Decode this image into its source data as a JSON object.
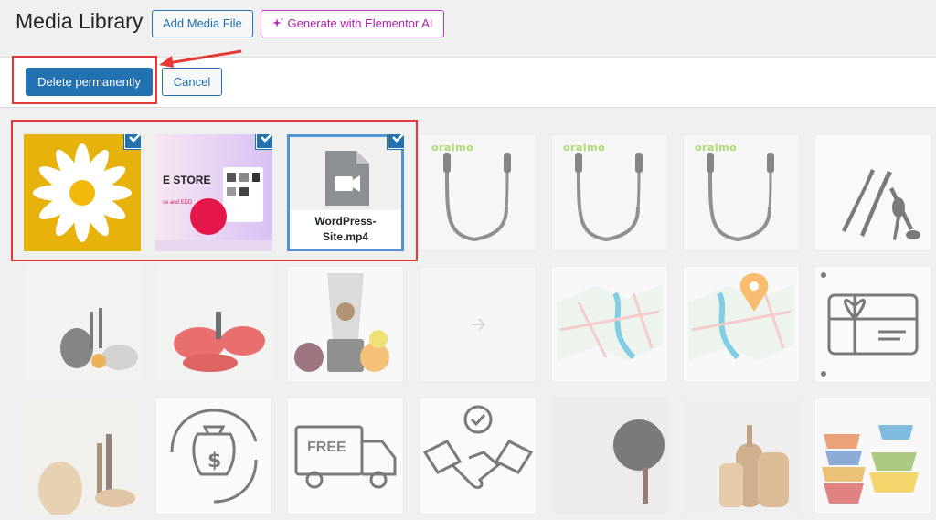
{
  "header": {
    "title": "Media Library",
    "add_media": "Add Media File",
    "generate_ai": "Generate with Elementor AI"
  },
  "toolbar": {
    "delete_permanently": "Delete permanently",
    "cancel": "Cancel"
  },
  "grid": {
    "items": [
      {
        "name": "daisy-flower",
        "selected": true
      },
      {
        "name": "store-theme-screenshot",
        "selected": true,
        "label": "STORE"
      },
      {
        "name": "video-file",
        "selected": true,
        "filename": "WordPress-Site.mp4"
      },
      {
        "name": "neckband-earphones",
        "brand": "oraimo"
      },
      {
        "name": "neckband-earphones",
        "brand": "oraimo"
      },
      {
        "name": "neckband-earphones",
        "brand": "oraimo"
      },
      {
        "name": "cutlery-icon"
      },
      {
        "name": "kitchen-kettle-set"
      },
      {
        "name": "red-cookware-set"
      },
      {
        "name": "blender-with-fruits"
      },
      {
        "name": "blank-placeholder"
      },
      {
        "name": "folded-map"
      },
      {
        "name": "folded-map-with-pin"
      },
      {
        "name": "gift-card-icon"
      },
      {
        "name": "wooden-kitchen-utensils"
      },
      {
        "name": "money-refund-icon"
      },
      {
        "name": "free-delivery-truck-icon",
        "label": "FREE"
      },
      {
        "name": "handshake-icon"
      },
      {
        "name": "frying-pan"
      },
      {
        "name": "cutting-boards"
      },
      {
        "name": "stacked-bowls"
      }
    ]
  },
  "colors": {
    "accent": "#2271b1",
    "annotation": "#e53935",
    "ai": "#c036d1"
  }
}
